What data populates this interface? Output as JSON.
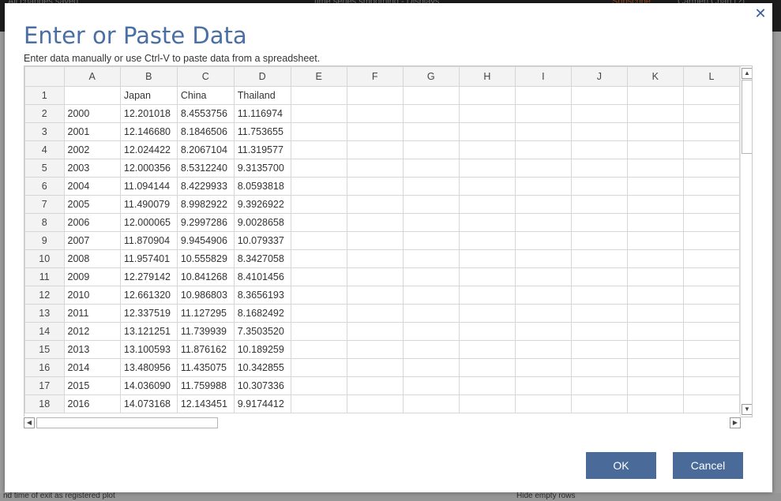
{
  "background": {
    "top_texts": [
      "All changes saved",
      "time series smoothing - Displays",
      "Subscribe",
      "Carmen Chan (?)"
    ],
    "bottom_texts": [
      "nd time of exit as registered plot",
      "Hide empty rows"
    ]
  },
  "dialog": {
    "title": "Enter or Paste Data",
    "subtitle": "Enter data manually or use Ctrl-V to paste data from a spreadsheet.",
    "ok_label": "OK",
    "cancel_label": "Cancel",
    "accent_color": "#4a6a9a"
  },
  "grid": {
    "columns": [
      "A",
      "B",
      "C",
      "D",
      "E",
      "F",
      "G",
      "H",
      "I",
      "J",
      "K",
      "L"
    ],
    "rows": [
      {
        "num": "1",
        "cells": [
          "",
          "Japan",
          "China",
          "Thailand"
        ]
      },
      {
        "num": "2",
        "cells": [
          "2000",
          "12.201018",
          "8.4553756",
          "11.116974"
        ]
      },
      {
        "num": "3",
        "cells": [
          "2001",
          "12.146680",
          "8.1846506",
          "11.753655"
        ]
      },
      {
        "num": "4",
        "cells": [
          "2002",
          "12.024422",
          "8.2067104",
          "11.319577"
        ]
      },
      {
        "num": "5",
        "cells": [
          "2003",
          "12.000356",
          "8.5312240",
          "9.3135700"
        ]
      },
      {
        "num": "6",
        "cells": [
          "2004",
          "11.094144",
          "8.4229933",
          "8.0593818"
        ]
      },
      {
        "num": "7",
        "cells": [
          "2005",
          "11.490079",
          "8.9982922",
          "9.3926922"
        ]
      },
      {
        "num": "8",
        "cells": [
          "2006",
          "12.000065",
          "9.2997286",
          "9.0028658"
        ]
      },
      {
        "num": "9",
        "cells": [
          "2007",
          "11.870904",
          "9.9454906",
          "10.079337"
        ]
      },
      {
        "num": "10",
        "cells": [
          "2008",
          "11.957401",
          "10.555829",
          "8.3427058"
        ]
      },
      {
        "num": "11",
        "cells": [
          "2009",
          "12.279142",
          "10.841268",
          "8.4101456"
        ]
      },
      {
        "num": "12",
        "cells": [
          "2010",
          "12.661320",
          "10.986803",
          "8.3656193"
        ]
      },
      {
        "num": "13",
        "cells": [
          "2011",
          "12.337519",
          "11.127295",
          "8.1682492"
        ]
      },
      {
        "num": "14",
        "cells": [
          "2012",
          "13.121251",
          "11.739939",
          "7.3503520"
        ]
      },
      {
        "num": "15",
        "cells": [
          "2013",
          "13.100593",
          "11.876162",
          "10.189259"
        ]
      },
      {
        "num": "16",
        "cells": [
          "2014",
          "13.480956",
          "11.435075",
          "10.342855"
        ]
      },
      {
        "num": "17",
        "cells": [
          "2015",
          "14.036090",
          "11.759988",
          "10.307336"
        ]
      },
      {
        "num": "18",
        "cells": [
          "2016",
          "14.073168",
          "12.143451",
          "9.9174412"
        ]
      }
    ]
  }
}
